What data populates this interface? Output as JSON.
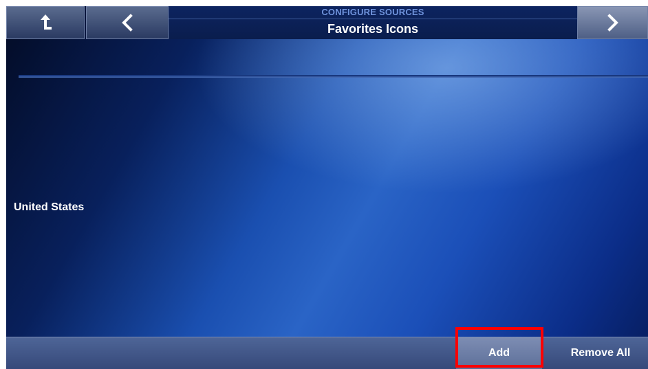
{
  "header": {
    "subtitle": "CONFIGURE SOURCES",
    "title": "Favorites Icons",
    "up_icon": "up-arrow-icon",
    "back_icon": "chevron-left-icon",
    "next_icon": "chevron-right-icon"
  },
  "list": {
    "items": [
      "United States"
    ]
  },
  "footer": {
    "add_label": "Add",
    "remove_all_label": "Remove All"
  },
  "colors": {
    "highlight": "#ff0000",
    "background_accent": "#1a4fb0"
  }
}
